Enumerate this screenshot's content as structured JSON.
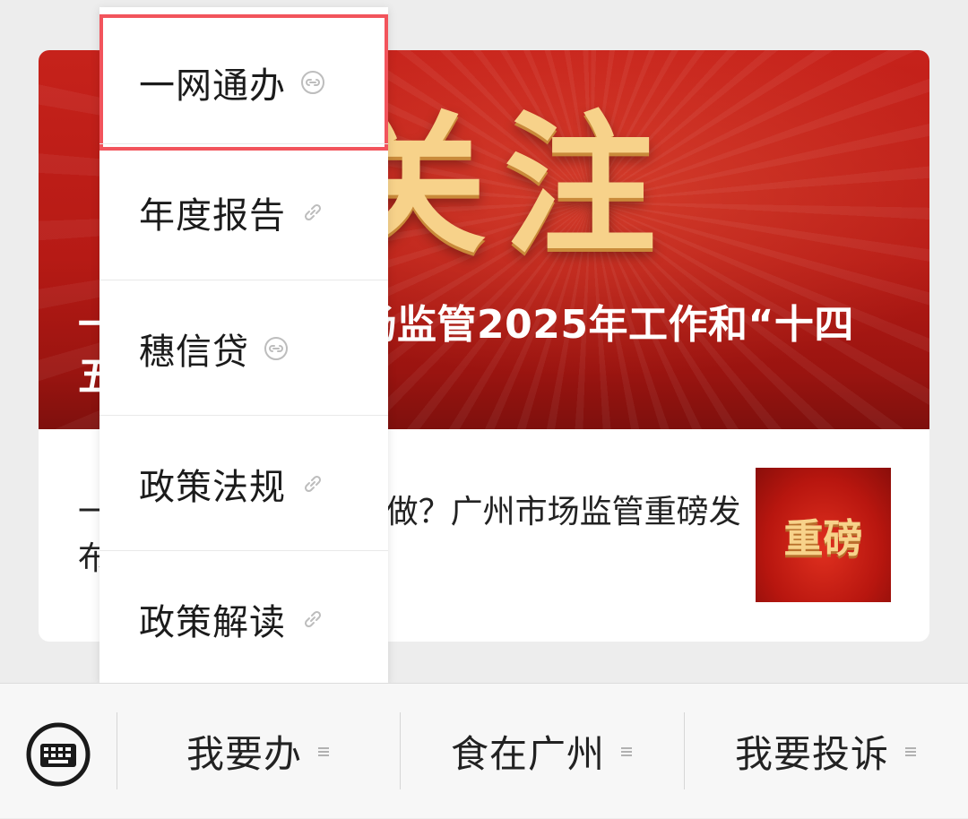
{
  "article": {
    "banner_big_text_left": "关",
    "banner_big_text_right": "注",
    "headline": "一图读懂广州市场监管2025年工作和“十四五”…",
    "summary": "一图读懂2025年怎么做？广州市场监管重磅发布",
    "thumbnail_text": "重磅"
  },
  "dropdown": {
    "items": [
      {
        "label": "一网通办",
        "icon": "mini-program-icon"
      },
      {
        "label": "年度报告",
        "icon": "link-icon"
      },
      {
        "label": "穗信贷",
        "icon": "mini-program-icon"
      },
      {
        "label": "政策法规",
        "icon": "link-icon"
      },
      {
        "label": "政策解读",
        "icon": "link-icon"
      }
    ],
    "highlight_color": "#f2545c"
  },
  "bottom_bar": {
    "keyboard_icon": "keyboard-icon",
    "tabs": [
      {
        "label": "我要办"
      },
      {
        "label": "食在广州"
      },
      {
        "label": "我要投诉"
      }
    ]
  },
  "colors": {
    "banner_red": "#c6221b",
    "gold_text": "#f7d28a"
  }
}
